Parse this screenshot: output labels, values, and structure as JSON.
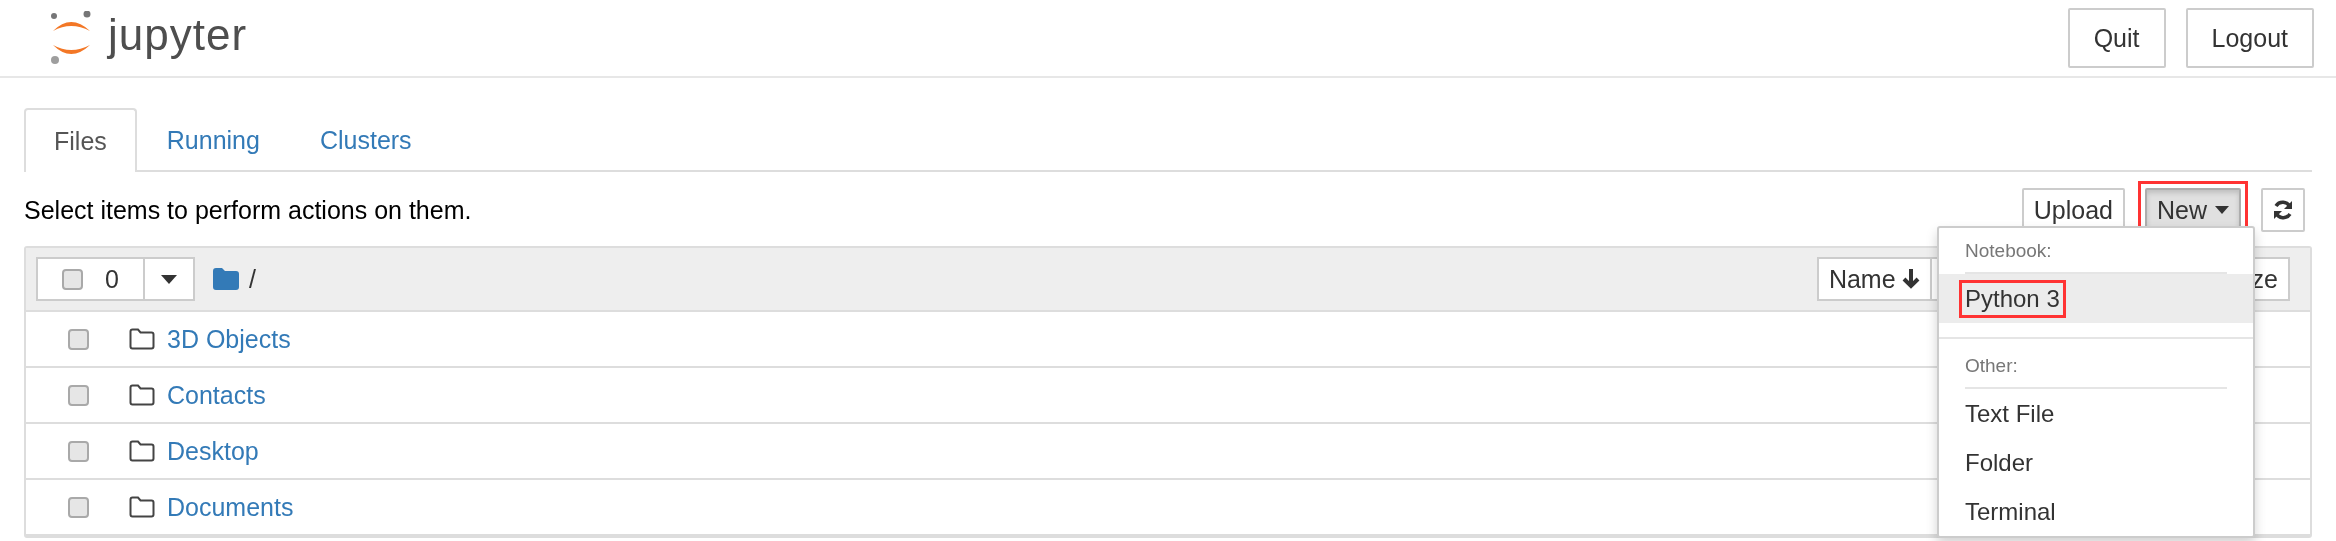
{
  "header": {
    "logo": "jupyter",
    "buttons": [
      "Quit",
      "Logout"
    ]
  },
  "tabs": [
    {
      "label": "Files",
      "selected": true
    },
    {
      "label": "Running",
      "selected": false
    },
    {
      "label": "Clusters",
      "selected": false
    }
  ],
  "toolbar": {
    "message": "Select items to perform actions on them.",
    "buttons": [
      {
        "kind": "text",
        "label": "Upload",
        "highlighted": false
      },
      {
        "kind": "dropdown",
        "label": "New",
        "highlighted": true,
        "expanded": true
      },
      {
        "kind": "refresh",
        "highlighted": false
      }
    ]
  },
  "list": {
    "all_checked": false,
    "selected_count": "0",
    "path": "/",
    "sort_label": "Name",
    "column_2": "ze",
    "rows": [
      {
        "name": "3D Objects",
        "checked": false
      },
      {
        "name": "Contacts",
        "checked": false
      },
      {
        "name": "Desktop",
        "checked": false
      },
      {
        "name": "Documents",
        "checked": false
      }
    ]
  },
  "menu": {
    "sections": [
      {
        "header": "Notebook:",
        "items": [
          {
            "label": "Python 3",
            "selected": true,
            "highlighted": true
          }
        ]
      },
      {
        "header": "Other:",
        "items": [
          {
            "label": "Text File",
            "selected": false,
            "highlighted": false
          },
          {
            "label": "Folder",
            "selected": false,
            "highlighted": false
          },
          {
            "label": "Terminal",
            "selected": false,
            "highlighted": false
          }
        ]
      }
    ]
  }
}
